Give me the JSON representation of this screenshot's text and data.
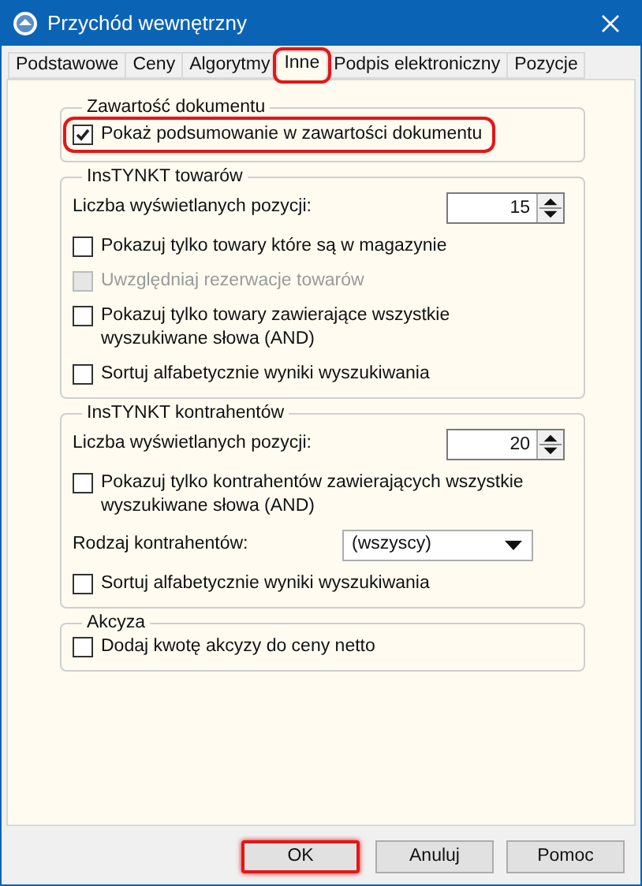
{
  "window": {
    "title": "Przychód wewnętrzny"
  },
  "tabs": [
    {
      "label": "Podstawowe",
      "selected": false,
      "highlighted": false
    },
    {
      "label": "Ceny",
      "selected": false,
      "highlighted": false
    },
    {
      "label": "Algorytmy",
      "selected": false,
      "highlighted": false
    },
    {
      "label": "Inne",
      "selected": true,
      "highlighted": true
    },
    {
      "label": "Podpis elektroniczny",
      "selected": false,
      "highlighted": false
    },
    {
      "label": "Pozycje",
      "selected": false,
      "highlighted": false
    }
  ],
  "groups": [
    {
      "title": "Zawartość dokumentu",
      "items": [
        {
          "kind": "checkbox",
          "label": "Pokaż podsumowanie w zawartości dokumentu",
          "checked": true,
          "disabled": false,
          "highlighted": true
        }
      ]
    },
    {
      "title": "InsTYNKT towarów",
      "items": [
        {
          "kind": "spinner",
          "label": "Liczba wyświetlanych pozycji:",
          "value": "15"
        },
        {
          "kind": "checkbox",
          "label": "Pokazuj tylko towary które są w magazynie",
          "checked": false,
          "disabled": false,
          "highlighted": false
        },
        {
          "kind": "checkbox",
          "label": "Uwzględniaj rezerwacje towarów",
          "checked": false,
          "disabled": true,
          "highlighted": false
        },
        {
          "kind": "checkbox",
          "label": "Pokazuj tylko towary zawierające wszystkie wyszukiwane słowa (AND)",
          "checked": false,
          "disabled": false,
          "highlighted": false
        },
        {
          "kind": "checkbox",
          "label": "Sortuj alfabetycznie wyniki wyszukiwania",
          "checked": false,
          "disabled": false,
          "highlighted": false
        }
      ]
    },
    {
      "title": "InsTYNKT kontrahentów",
      "items": [
        {
          "kind": "spinner",
          "label": "Liczba wyświetlanych pozycji:",
          "value": "20"
        },
        {
          "kind": "checkbox",
          "label": "Pokazuj tylko kontrahentów zawierających wszystkie wyszukiwane słowa (AND)",
          "checked": false,
          "disabled": false,
          "highlighted": false
        },
        {
          "kind": "dropdown",
          "label": "Rodzaj kontrahentów:",
          "value": "(wszyscy)"
        },
        {
          "kind": "checkbox",
          "label": "Sortuj alfabetycznie wyniki wyszukiwania",
          "checked": false,
          "disabled": false,
          "highlighted": false
        }
      ]
    },
    {
      "title": "Akcyza",
      "items": [
        {
          "kind": "checkbox",
          "label": "Dodaj kwotę akcyzy do ceny netto",
          "checked": false,
          "disabled": false,
          "highlighted": false
        }
      ]
    }
  ],
  "buttons": [
    {
      "label": "OK",
      "highlighted": true
    },
    {
      "label": "Anuluj",
      "highlighted": false
    },
    {
      "label": "Pomoc",
      "highlighted": false
    }
  ]
}
